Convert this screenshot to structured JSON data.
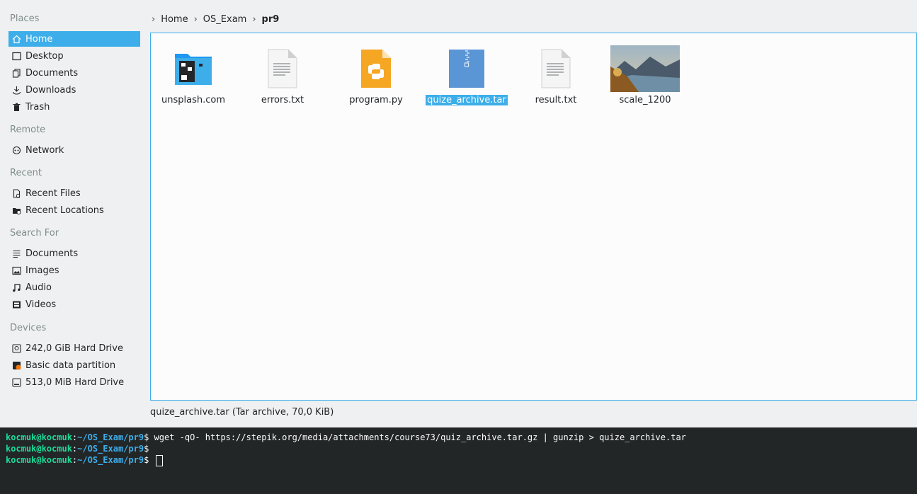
{
  "sidebar": {
    "sections": {
      "places": "Places",
      "remote": "Remote",
      "recent": "Recent",
      "search": "Search For",
      "devices": "Devices"
    },
    "places": [
      {
        "label": "Home",
        "icon": "home-icon"
      },
      {
        "label": "Desktop",
        "icon": "desktop-icon"
      },
      {
        "label": "Documents",
        "icon": "documents-icon"
      },
      {
        "label": "Downloads",
        "icon": "downloads-icon"
      },
      {
        "label": "Trash",
        "icon": "trash-icon"
      }
    ],
    "remote": [
      {
        "label": "Network",
        "icon": "network-icon"
      }
    ],
    "recent": [
      {
        "label": "Recent Files",
        "icon": "recent-files-icon"
      },
      {
        "label": "Recent Locations",
        "icon": "recent-locations-icon"
      }
    ],
    "search": [
      {
        "label": "Documents",
        "icon": "search-documents-icon"
      },
      {
        "label": "Images",
        "icon": "images-icon"
      },
      {
        "label": "Audio",
        "icon": "audio-icon"
      },
      {
        "label": "Videos",
        "icon": "videos-icon"
      }
    ],
    "devices": [
      {
        "label": "242,0 GiB Hard Drive",
        "icon": "hard-drive-icon"
      },
      {
        "label": "Basic data partition",
        "icon": "partition-icon"
      },
      {
        "label": "513,0 MiB Hard Drive",
        "icon": "hard-drive-icon"
      }
    ]
  },
  "breadcrumb": {
    "items": [
      "Home",
      "OS_Exam",
      "pr9"
    ]
  },
  "files": [
    {
      "name": "unsplash.com",
      "type": "folder"
    },
    {
      "name": "errors.txt",
      "type": "text"
    },
    {
      "name": "program.py",
      "type": "python"
    },
    {
      "name": "quize_archive.tar",
      "type": "archive"
    },
    {
      "name": "result.txt",
      "type": "text"
    },
    {
      "name": "scale_1200",
      "type": "image"
    }
  ],
  "status": "quize_archive.tar (Tar archive, 70,0 KiB)",
  "terminal": {
    "user": "kocmuk@kocmuk",
    "path": "~/OS_Exam/pr9",
    "lines": [
      "wget -qO- https://stepik.org/media/attachments/course73/quiz_archive.tar.gz | gunzip > quize_archive.tar",
      "",
      ""
    ]
  },
  "colors": {
    "accent": "#3daee9",
    "terminal_bg": "#232627",
    "prompt_user": "#1cdc9a"
  }
}
